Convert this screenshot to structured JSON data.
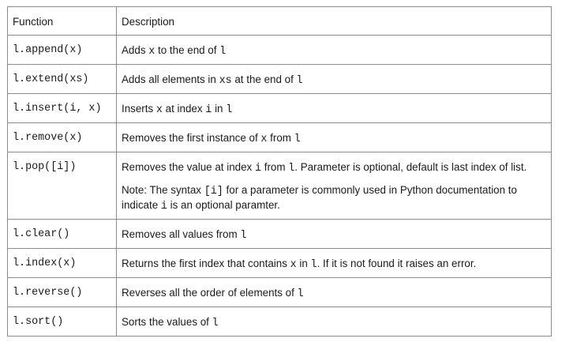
{
  "header": {
    "function": "Function",
    "description": "Description"
  },
  "rows": [
    {
      "function": "l.append(x)",
      "desc": [
        {
          "t": "text",
          "v": "Adds "
        },
        {
          "t": "code",
          "v": "x"
        },
        {
          "t": "text",
          "v": " to the end of "
        },
        {
          "t": "code",
          "v": "l"
        }
      ]
    },
    {
      "function": "l.extend(xs)",
      "desc": [
        {
          "t": "text",
          "v": "Adds all elements in "
        },
        {
          "t": "code",
          "v": "xs"
        },
        {
          "t": "text",
          "v": " at the end of "
        },
        {
          "t": "code",
          "v": "l"
        }
      ]
    },
    {
      "function": "l.insert(i, x)",
      "desc": [
        {
          "t": "text",
          "v": "Inserts "
        },
        {
          "t": "code",
          "v": "x"
        },
        {
          "t": "text",
          "v": " at index "
        },
        {
          "t": "code",
          "v": "i"
        },
        {
          "t": "text",
          "v": " in "
        },
        {
          "t": "code",
          "v": "l"
        }
      ]
    },
    {
      "function": "l.remove(x)",
      "desc": [
        {
          "t": "text",
          "v": "Removes the first instance of "
        },
        {
          "t": "code",
          "v": "x"
        },
        {
          "t": "text",
          "v": " from "
        },
        {
          "t": "code",
          "v": "l"
        }
      ]
    },
    {
      "function": "l.pop([i])",
      "desc": [
        {
          "t": "text",
          "v": "Removes the value at index "
        },
        {
          "t": "code",
          "v": "i"
        },
        {
          "t": "text",
          "v": " from "
        },
        {
          "t": "code",
          "v": "l"
        },
        {
          "t": "text",
          "v": ". Parameter is optional, default is last index of list."
        }
      ],
      "note": [
        {
          "t": "text",
          "v": "Note: The syntax "
        },
        {
          "t": "code",
          "v": "[i]"
        },
        {
          "t": "text",
          "v": " for a parameter is commonly used in Python documentation to indicate "
        },
        {
          "t": "code",
          "v": "i"
        },
        {
          "t": "text",
          "v": " is an optional paramter."
        }
      ]
    },
    {
      "function": "l.clear()",
      "desc": [
        {
          "t": "text",
          "v": "Removes all values from "
        },
        {
          "t": "code",
          "v": "l"
        }
      ]
    },
    {
      "function": "l.index(x)",
      "desc": [
        {
          "t": "text",
          "v": "Returns the first index that contains "
        },
        {
          "t": "code",
          "v": "x"
        },
        {
          "t": "text",
          "v": " in "
        },
        {
          "t": "code",
          "v": "l"
        },
        {
          "t": "text",
          "v": ". If it is not found it raises an error."
        }
      ]
    },
    {
      "function": "l.reverse()",
      "desc": [
        {
          "t": "text",
          "v": "Reverses all the order of elements of "
        },
        {
          "t": "code",
          "v": "l"
        }
      ]
    },
    {
      "function": "l.sort()",
      "desc": [
        {
          "t": "text",
          "v": "Sorts the values of "
        },
        {
          "t": "code",
          "v": "l"
        }
      ]
    }
  ]
}
